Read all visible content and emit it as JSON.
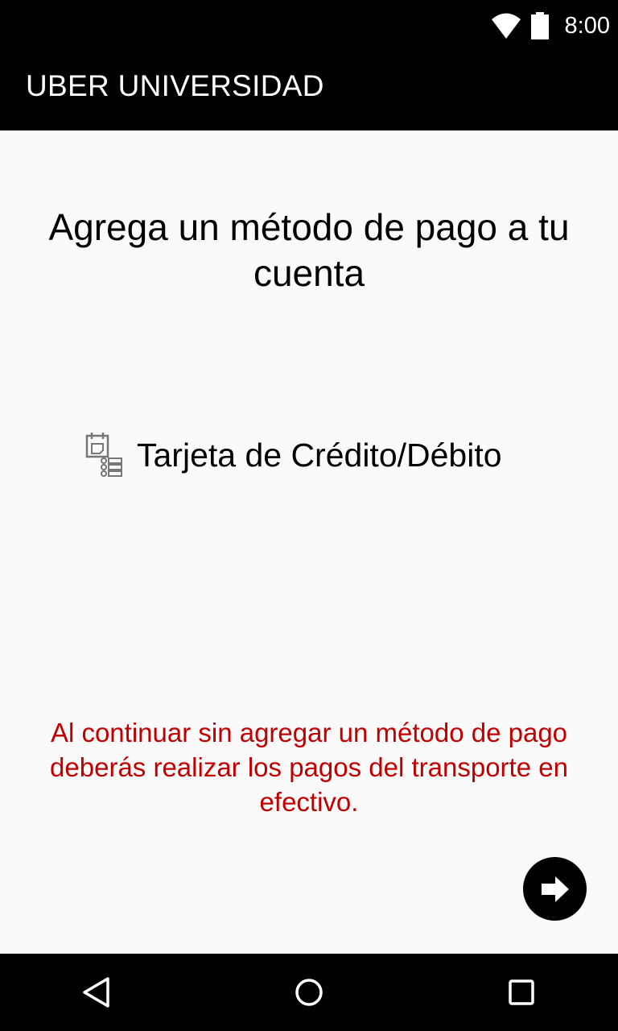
{
  "status_bar": {
    "time": "8:00",
    "icons": [
      "wifi-icon",
      "battery-icon"
    ]
  },
  "app_bar": {
    "title": "UBER UNIVERSIDAD"
  },
  "main": {
    "heading": "Agrega un método de pago a tu cuenta",
    "payment_option": {
      "icon": "credit-card-form-icon",
      "label": "Tarjeta de Crédito/Débito"
    },
    "notice": "Al continuar sin agregar un método de pago deberás realizar los pagos del transporte en efectivo.",
    "next_button": {
      "icon": "arrow-right-icon"
    }
  },
  "nav_bar": {
    "buttons": [
      "back-icon",
      "home-icon",
      "recents-icon"
    ]
  },
  "colors": {
    "bar_background": "#000000",
    "page_background": "#fafafa",
    "notice_text": "#c00000",
    "primary_text": "#000000"
  }
}
